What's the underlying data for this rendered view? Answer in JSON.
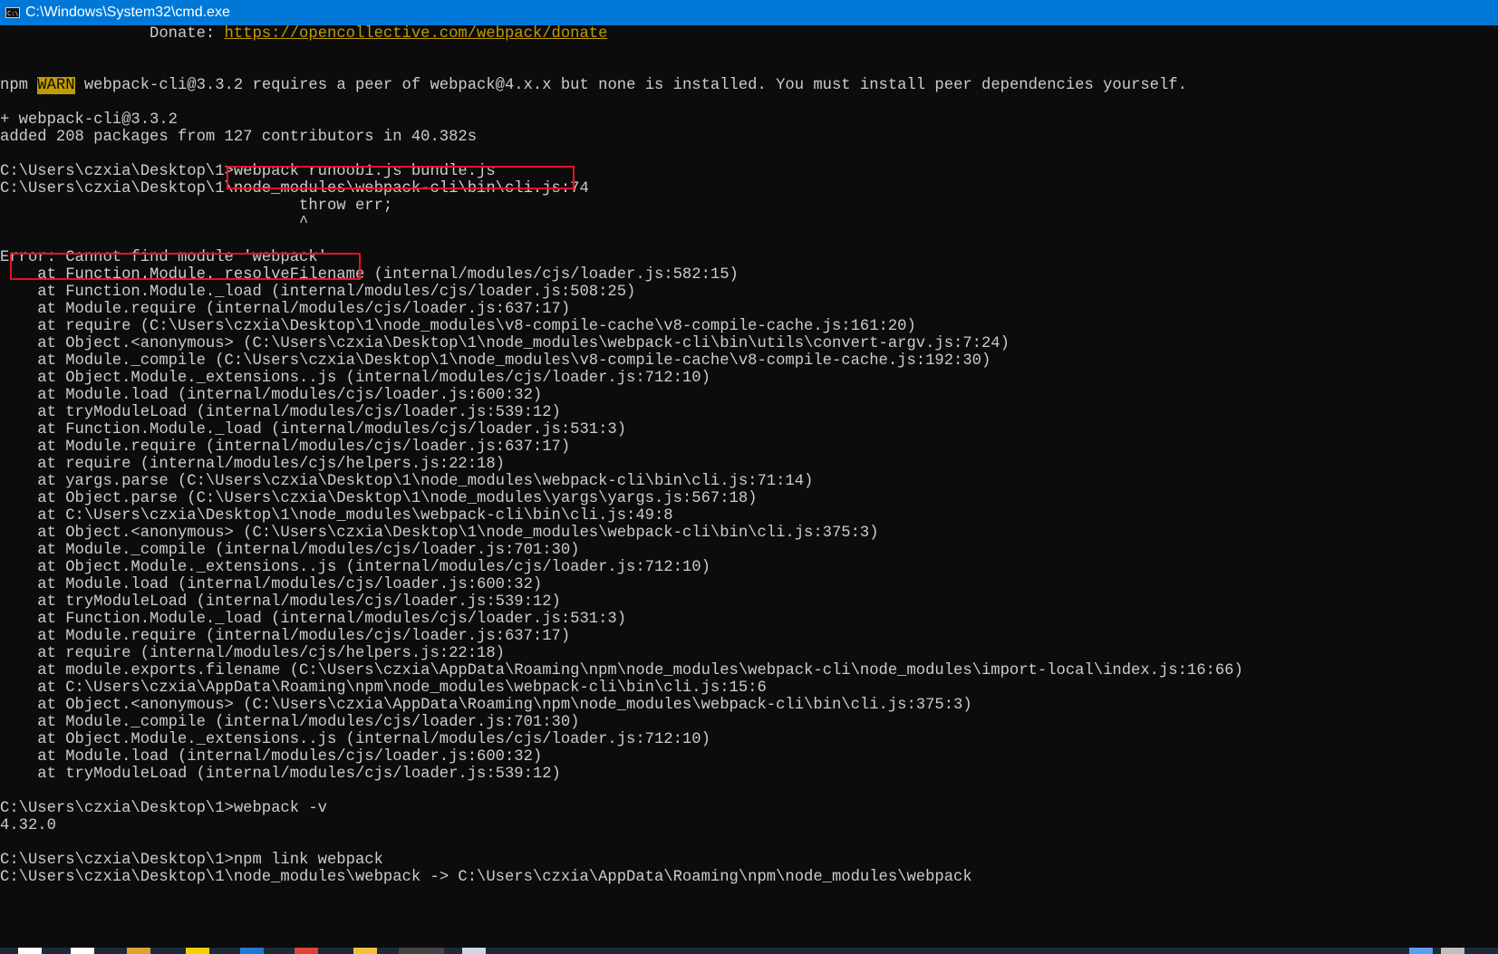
{
  "window": {
    "title": "C:\\Windows\\System32\\cmd.exe",
    "icon": "console-window-icon",
    "icon_text": "C:\\"
  },
  "console": {
    "lines": [
      {
        "parts": [
          {
            "text": "                Donate: "
          },
          {
            "text": "https://opencollective.com/webpack/donate",
            "style": "link"
          }
        ]
      },
      {
        "parts": [
          {
            "text": ""
          }
        ]
      },
      {
        "parts": [
          {
            "text": ""
          }
        ]
      },
      {
        "parts": [
          {
            "text": "npm "
          },
          {
            "text": "WARN",
            "style": "warn"
          },
          {
            "text": " webpack-cli@3.3.2 requires a peer of webpack@4.x.x but none is installed. You must install peer dependencies yourself."
          }
        ]
      },
      {
        "parts": [
          {
            "text": ""
          }
        ]
      },
      {
        "parts": [
          {
            "text": "+ webpack-cli@3.3.2"
          }
        ]
      },
      {
        "parts": [
          {
            "text": "added 208 packages from 127 contributors in 40.382s"
          }
        ]
      },
      {
        "parts": [
          {
            "text": ""
          }
        ]
      },
      {
        "parts": [
          {
            "text": "C:\\Users\\czxia\\Desktop\\1>webpack runoob1.js bundle.js"
          }
        ]
      },
      {
        "parts": [
          {
            "text": "C:\\Users\\czxia\\Desktop\\1\\node_modules\\webpack-cli\\bin\\cli.js:74"
          }
        ]
      },
      {
        "parts": [
          {
            "text": "                                throw err;"
          }
        ]
      },
      {
        "parts": [
          {
            "text": "                                ^"
          }
        ]
      },
      {
        "parts": [
          {
            "text": ""
          }
        ]
      },
      {
        "parts": [
          {
            "text": "Error: Cannot find module 'webpack'"
          }
        ]
      },
      {
        "parts": [
          {
            "text": "    at Function.Module._resolveFilename (internal/modules/cjs/loader.js:582:15)"
          }
        ]
      },
      {
        "parts": [
          {
            "text": "    at Function.Module._load (internal/modules/cjs/loader.js:508:25)"
          }
        ]
      },
      {
        "parts": [
          {
            "text": "    at Module.require (internal/modules/cjs/loader.js:637:17)"
          }
        ]
      },
      {
        "parts": [
          {
            "text": "    at require (C:\\Users\\czxia\\Desktop\\1\\node_modules\\v8-compile-cache\\v8-compile-cache.js:161:20)"
          }
        ]
      },
      {
        "parts": [
          {
            "text": "    at Object.<anonymous> (C:\\Users\\czxia\\Desktop\\1\\node_modules\\webpack-cli\\bin\\utils\\convert-argv.js:7:24)"
          }
        ]
      },
      {
        "parts": [
          {
            "text": "    at Module._compile (C:\\Users\\czxia\\Desktop\\1\\node_modules\\v8-compile-cache\\v8-compile-cache.js:192:30)"
          }
        ]
      },
      {
        "parts": [
          {
            "text": "    at Object.Module._extensions..js (internal/modules/cjs/loader.js:712:10)"
          }
        ]
      },
      {
        "parts": [
          {
            "text": "    at Module.load (internal/modules/cjs/loader.js:600:32)"
          }
        ]
      },
      {
        "parts": [
          {
            "text": "    at tryModuleLoad (internal/modules/cjs/loader.js:539:12)"
          }
        ]
      },
      {
        "parts": [
          {
            "text": "    at Function.Module._load (internal/modules/cjs/loader.js:531:3)"
          }
        ]
      },
      {
        "parts": [
          {
            "text": "    at Module.require (internal/modules/cjs/loader.js:637:17)"
          }
        ]
      },
      {
        "parts": [
          {
            "text": "    at require (internal/modules/cjs/helpers.js:22:18)"
          }
        ]
      },
      {
        "parts": [
          {
            "text": "    at yargs.parse (C:\\Users\\czxia\\Desktop\\1\\node_modules\\webpack-cli\\bin\\cli.js:71:14)"
          }
        ]
      },
      {
        "parts": [
          {
            "text": "    at Object.parse (C:\\Users\\czxia\\Desktop\\1\\node_modules\\yargs\\yargs.js:567:18)"
          }
        ]
      },
      {
        "parts": [
          {
            "text": "    at C:\\Users\\czxia\\Desktop\\1\\node_modules\\webpack-cli\\bin\\cli.js:49:8"
          }
        ]
      },
      {
        "parts": [
          {
            "text": "    at Object.<anonymous> (C:\\Users\\czxia\\Desktop\\1\\node_modules\\webpack-cli\\bin\\cli.js:375:3)"
          }
        ]
      },
      {
        "parts": [
          {
            "text": "    at Module._compile (internal/modules/cjs/loader.js:701:30)"
          }
        ]
      },
      {
        "parts": [
          {
            "text": "    at Object.Module._extensions..js (internal/modules/cjs/loader.js:712:10)"
          }
        ]
      },
      {
        "parts": [
          {
            "text": "    at Module.load (internal/modules/cjs/loader.js:600:32)"
          }
        ]
      },
      {
        "parts": [
          {
            "text": "    at tryModuleLoad (internal/modules/cjs/loader.js:539:12)"
          }
        ]
      },
      {
        "parts": [
          {
            "text": "    at Function.Module._load (internal/modules/cjs/loader.js:531:3)"
          }
        ]
      },
      {
        "parts": [
          {
            "text": "    at Module.require (internal/modules/cjs/loader.js:637:17)"
          }
        ]
      },
      {
        "parts": [
          {
            "text": "    at require (internal/modules/cjs/helpers.js:22:18)"
          }
        ]
      },
      {
        "parts": [
          {
            "text": "    at module.exports.filename (C:\\Users\\czxia\\AppData\\Roaming\\npm\\node_modules\\webpack-cli\\node_modules\\import-local\\index.js:16:66)"
          }
        ]
      },
      {
        "parts": [
          {
            "text": "    at C:\\Users\\czxia\\AppData\\Roaming\\npm\\node_modules\\webpack-cli\\bin\\cli.js:15:6"
          }
        ]
      },
      {
        "parts": [
          {
            "text": "    at Object.<anonymous> (C:\\Users\\czxia\\AppData\\Roaming\\npm\\node_modules\\webpack-cli\\bin\\cli.js:375:3)"
          }
        ]
      },
      {
        "parts": [
          {
            "text": "    at Module._compile (internal/modules/cjs/loader.js:701:30)"
          }
        ]
      },
      {
        "parts": [
          {
            "text": "    at Object.Module._extensions..js (internal/modules/cjs/loader.js:712:10)"
          }
        ]
      },
      {
        "parts": [
          {
            "text": "    at Module.load (internal/modules/cjs/loader.js:600:32)"
          }
        ]
      },
      {
        "parts": [
          {
            "text": "    at tryModuleLoad (internal/modules/cjs/loader.js:539:12)"
          }
        ]
      },
      {
        "parts": [
          {
            "text": ""
          }
        ]
      },
      {
        "parts": [
          {
            "text": "C:\\Users\\czxia\\Desktop\\1>webpack -v"
          }
        ]
      },
      {
        "parts": [
          {
            "text": "4.32.0"
          }
        ]
      },
      {
        "parts": [
          {
            "text": ""
          }
        ]
      },
      {
        "parts": [
          {
            "text": "C:\\Users\\czxia\\Desktop\\1>npm link webpack"
          }
        ]
      },
      {
        "parts": [
          {
            "text": "C:\\Users\\czxia\\Desktop\\1\\node_modules\\webpack -> C:\\Users\\czxia\\AppData\\Roaming\\npm\\node_modules\\webpack"
          }
        ]
      }
    ]
  },
  "colors": {
    "console_bg": "#0c0c0c",
    "console_fg": "#cccccc",
    "titlebar_bg": "#0078d7",
    "warn_bg": "#c19c00",
    "link_fg": "#c19c00",
    "annotation_box": "#e81123",
    "taskbar_bg": "#1c2a3a"
  },
  "taskbar": {
    "items": [
      {
        "icon": "windows-start-icon",
        "color": "#ffffff"
      },
      {
        "icon": "search-icon",
        "color": "#ffffff"
      },
      {
        "icon": "pdf-app-icon",
        "color": "#e0a030"
      },
      {
        "icon": "sticky-notes-icon",
        "color": "#f5d000"
      },
      {
        "icon": "edge-browser-icon",
        "color": "#1f7ad6"
      },
      {
        "icon": "chrome-browser-icon",
        "color": "#db4437"
      },
      {
        "icon": "file-explorer-icon",
        "color": "#f0c040"
      },
      {
        "icon": "cmd-taskbar-icon",
        "color": "#444444"
      },
      {
        "icon": "notepad-icon",
        "color": "#c9d7e6"
      },
      {
        "icon": "help-icon",
        "color": "#5c9ded"
      },
      {
        "icon": "network-icon",
        "color": "#bfbfbf"
      }
    ]
  }
}
